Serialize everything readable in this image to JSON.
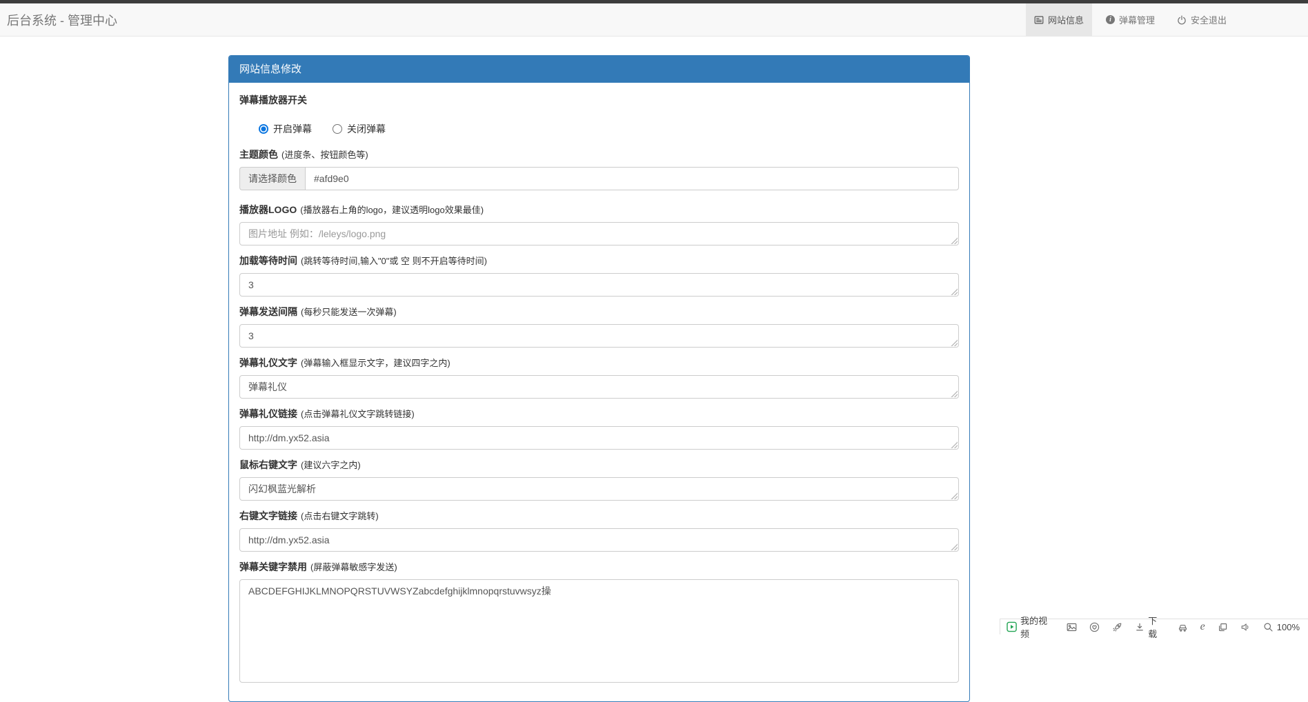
{
  "header": {
    "brand": "后台系统 - 管理中心",
    "nav": [
      {
        "label": "网站信息",
        "icon": "list-alt-icon",
        "active": true
      },
      {
        "label": "弹幕管理",
        "icon": "info-icon",
        "active": false
      },
      {
        "label": "安全退出",
        "icon": "power-icon",
        "active": false
      }
    ]
  },
  "panel": {
    "title": "网站信息修改",
    "fields": [
      {
        "type": "radio-group",
        "label": "弹幕播放器开关",
        "hint": "",
        "options": [
          {
            "label": "开启弹幕",
            "checked": true
          },
          {
            "label": "关闭弹幕",
            "checked": false
          }
        ]
      },
      {
        "type": "input-group",
        "label": "主题颜色",
        "hint": "(进度条、按钮颜色等)",
        "addon": "请选择颜色",
        "value": "#afd9e0"
      },
      {
        "type": "text",
        "label": "播放器LOGO",
        "hint": "(播放器右上角的logo，建议透明logo效果最佳)",
        "value": "",
        "placeholder": "图片地址 例如：/leleys/logo.png"
      },
      {
        "type": "text",
        "label": "加载等待时间",
        "hint": "(跳转等待时间,输入\"0\"或 空 则不开启等待时间)",
        "value": "3",
        "placeholder": ""
      },
      {
        "type": "text",
        "label": "弹幕发送间隔",
        "hint": "(每秒只能发送一次弹幕)",
        "value": "3",
        "placeholder": ""
      },
      {
        "type": "text",
        "label": "弹幕礼仪文字",
        "hint": "(弹幕输入框显示文字，建议四字之内)",
        "value": "弹幕礼仪",
        "placeholder": ""
      },
      {
        "type": "text",
        "label": "弹幕礼仪链接",
        "hint": "(点击弹幕礼仪文字跳转链接)",
        "value": "http://dm.yx52.asia",
        "placeholder": ""
      },
      {
        "type": "text",
        "label": "鼠标右键文字",
        "hint": "(建议六字之内)",
        "value": "闪幻枫蓝光解析",
        "placeholder": ""
      },
      {
        "type": "text",
        "label": "右键文字链接",
        "hint": "(点击右键文字跳转)",
        "value": "http://dm.yx52.asia",
        "placeholder": ""
      },
      {
        "type": "textarea",
        "label": "弹幕关键字禁用",
        "hint": "(屏蔽弹幕敏感字发送)",
        "value": "ABCDEFGHIJKLMNOPQRSTUVWSYZabcdefghijklmnopqrstuvwsyz操"
      }
    ]
  },
  "status_bar": {
    "my_video": "我的视频",
    "download": "下载",
    "zoom": "100%"
  },
  "colors": {
    "accent": "#337ab7",
    "navbar_bg": "#f8f8f8",
    "nav_active_bg": "#e7e7e7",
    "radio_selected": "#0b76e0",
    "play_green": "#21a453",
    "theme_color_value": "#afd9e0"
  }
}
